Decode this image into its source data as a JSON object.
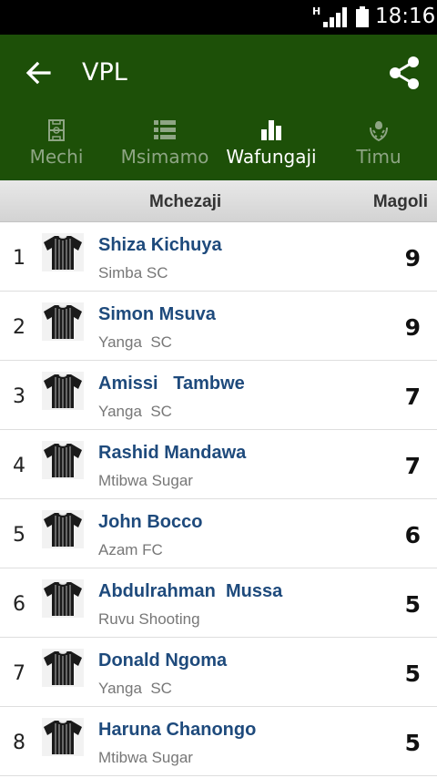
{
  "status_bar": {
    "network": "H",
    "time": "18:16"
  },
  "app_bar": {
    "title": "VPL"
  },
  "icons": {
    "back": "arrow-left-icon",
    "share": "share-icon",
    "signal": "signal-icon",
    "battery": "battery-icon"
  },
  "tabs": [
    {
      "label": "Mechi",
      "icon": "field-icon",
      "active": false
    },
    {
      "label": "Msimamo",
      "icon": "list-icon",
      "active": false
    },
    {
      "label": "Wafungaji",
      "icon": "bar-chart-icon",
      "active": true
    },
    {
      "label": "Timu",
      "icon": "crest-icon",
      "active": false
    }
  ],
  "table": {
    "header_player": "Mchezaji",
    "header_goals": "Magoli",
    "rows": [
      {
        "rank": "1",
        "name": "Shiza Kichuya",
        "team": "Simba SC",
        "goals": "9"
      },
      {
        "rank": "2",
        "name": "Simon Msuva",
        "team": "Yanga  SC",
        "goals": "9"
      },
      {
        "rank": "3",
        "name": "Amissi   Tambwe",
        "team": "Yanga  SC",
        "goals": "7"
      },
      {
        "rank": "4",
        "name": "Rashid Mandawa",
        "team": "Mtibwa Sugar",
        "goals": "7"
      },
      {
        "rank": "5",
        "name": "John Bocco",
        "team": "Azam FC",
        "goals": "6"
      },
      {
        "rank": "6",
        "name": "Abdulrahman  Mussa",
        "team": "Ruvu Shooting",
        "goals": "5"
      },
      {
        "rank": "7",
        "name": "Donald Ngoma",
        "team": "Yanga  SC",
        "goals": "5"
      },
      {
        "rank": "8",
        "name": "Haruna Chanongo",
        "team": "Mtibwa Sugar",
        "goals": "5"
      }
    ]
  },
  "colors": {
    "app_bar": "#1d5008",
    "player_name": "#1e4a7c",
    "tab_inactive": "#8ea584",
    "tab_active": "#ffffff"
  }
}
